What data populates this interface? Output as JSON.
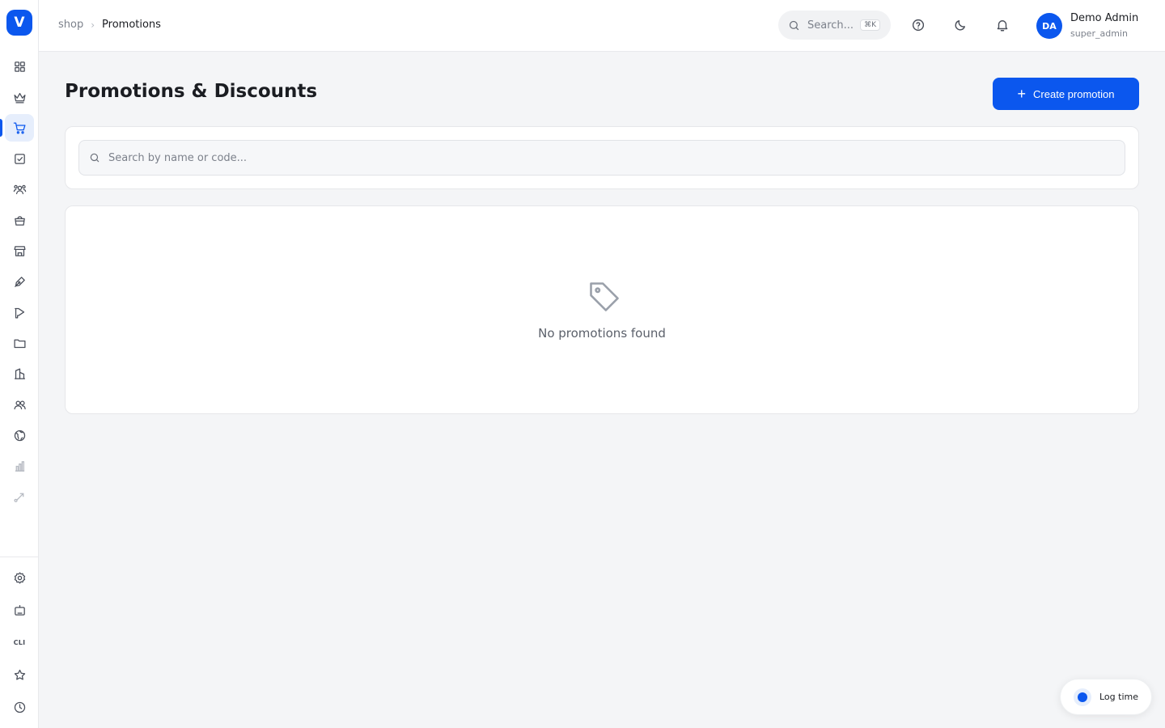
{
  "app": {
    "logo_letter": "V"
  },
  "sidebar": {
    "items": [
      {
        "name": "sidebar-item-dashboard",
        "icon": "grid-icon"
      },
      {
        "name": "sidebar-item-crown",
        "icon": "crown-icon"
      },
      {
        "name": "sidebar-item-shop",
        "icon": "cart-icon",
        "active": true
      },
      {
        "name": "sidebar-item-tasks",
        "icon": "checkbox-icon"
      },
      {
        "name": "sidebar-item-teams",
        "icon": "users-group-icon"
      },
      {
        "name": "sidebar-item-store-bag",
        "icon": "shopping-bag-icon"
      },
      {
        "name": "sidebar-item-store",
        "icon": "storefront-icon"
      },
      {
        "name": "sidebar-item-design",
        "icon": "pen-nib-icon"
      },
      {
        "name": "sidebar-item-campaigns",
        "icon": "megaphone-icon"
      },
      {
        "name": "sidebar-item-files",
        "icon": "folder-icon"
      },
      {
        "name": "sidebar-item-company",
        "icon": "building-icon"
      },
      {
        "name": "sidebar-item-people",
        "icon": "people-icon"
      },
      {
        "name": "sidebar-item-global",
        "icon": "globe-icon"
      },
      {
        "name": "sidebar-item-analytics",
        "icon": "bar-chart-icon"
      },
      {
        "name": "sidebar-item-workflows",
        "icon": "route-icon"
      }
    ],
    "bottom": {
      "settings": "gear-icon",
      "bot": "robot-icon",
      "cli_label": "CLI",
      "favorites": "star-icon",
      "history": "clock-icon"
    }
  },
  "header": {
    "breadcrumb": {
      "parent": "shop",
      "separator": "›",
      "current": "Promotions"
    },
    "search": {
      "placeholder": "Search...",
      "shortcut": "⌘K"
    },
    "user": {
      "initials": "DA",
      "name": "Demo Admin",
      "role": "super_admin"
    }
  },
  "main": {
    "title": "Promotions & Discounts",
    "create_button": "Create promotion",
    "filter": {
      "placeholder": "Search by name or code..."
    },
    "empty_state": {
      "icon": "tag-icon",
      "message": "No promotions found"
    }
  },
  "log_time": {
    "label": "Log time"
  },
  "colors": {
    "accent": "#0b57ee",
    "background": "#f4f5f7",
    "surface": "#ffffff"
  }
}
